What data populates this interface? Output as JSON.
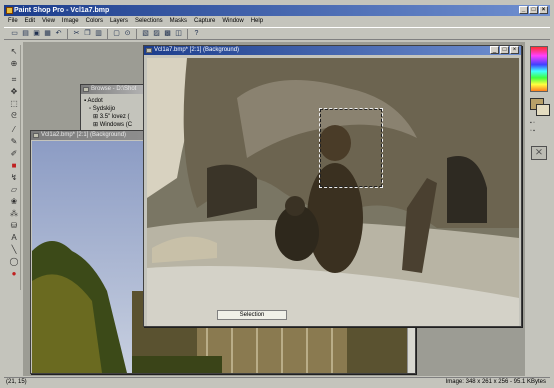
{
  "app": {
    "title": "Paint Shop Pro - Vcl1a7.bmp",
    "window_controls": [
      "_",
      "□",
      "×"
    ]
  },
  "menubar": [
    "File",
    "Edit",
    "View",
    "Image",
    "Colors",
    "Layers",
    "Selections",
    "Masks",
    "Capture",
    "Window",
    "Help"
  ],
  "toolbar_icons": [
    "new-icon",
    "open-icon",
    "save-icon",
    "print-icon",
    "undo-icon",
    "cut-icon",
    "copy-icon",
    "paste-icon",
    "capture-icon",
    "zoom-icon",
    "browse-icon",
    "histogram-icon",
    "palette-icon",
    "layers-icon",
    "help-icon"
  ],
  "tool_icons": [
    "select-arrow-icon",
    "zoom-tool-icon",
    "crop-icon",
    "move-icon",
    "selection-icon",
    "lasso-icon",
    "eyedropper-icon",
    "paintbrush-icon",
    "clone-icon",
    "color-replacer-icon",
    "retouch-icon",
    "eraser-icon",
    "picture-tube-icon",
    "airbrush-icon",
    "flood-fill-icon",
    "text-tool-icon",
    "line-tool-icon",
    "shape-tool-icon",
    "mask-icon"
  ],
  "browser_window": {
    "title": "Browse - D:\\Shot",
    "tree": [
      "Acdot",
      "Sydskijo",
      "3.5\" lovez (",
      "Windows (C"
    ]
  },
  "back_window": {
    "title": "Vcl1a2.bmp* [2:1] (Background)"
  },
  "front_window": {
    "title": "Vcl1a7.bmp* [2:1] (Background)",
    "image_tooltip": "Selection"
  },
  "statusbar": {
    "coords": "(21, 15)",
    "image_info": "Image: 348 x 261 x 256 - 95.1 KBytes"
  },
  "colors": {
    "title_active": "#1c3d8c",
    "title_active_end": "#6f8fd0",
    "title_inactive": "#7c7c7c",
    "workspace": "#9c9c94",
    "chrome": "#c4c4bc",
    "fg_swatch": "#b8a068",
    "bg_swatch": "#e4dcc0"
  }
}
